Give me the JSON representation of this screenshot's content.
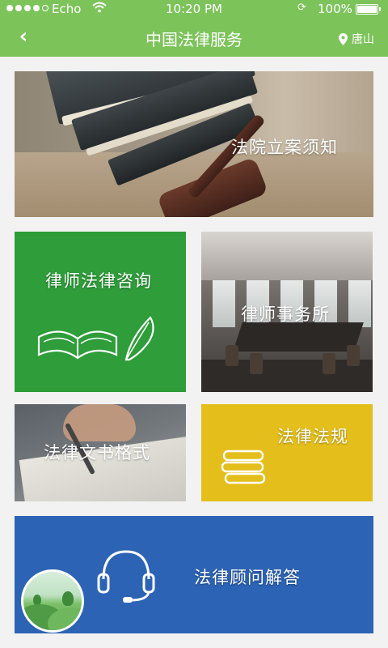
{
  "status_bar": {
    "carrier": "Echo",
    "time": "10:20 PM",
    "battery": "100%",
    "signal_icon": "signal-dots-icon",
    "wifi_icon": "wifi-icon",
    "battery_icon": "battery-icon"
  },
  "nav": {
    "title": "中国法律服务",
    "back_icon": "back-chevron-icon",
    "location": "唐山",
    "accent_color": "#7cc35a"
  },
  "tiles": {
    "banner": "法院立案须知",
    "consult": "律师法律咨询",
    "firm": "律师事务所",
    "docs": "法律文书格式",
    "laws": "法律法规",
    "advisor": "法律顾问解答"
  },
  "colors": {
    "consult": "#2e9d3a",
    "laws": "#e4be1b",
    "advisor": "#2c63b4"
  }
}
